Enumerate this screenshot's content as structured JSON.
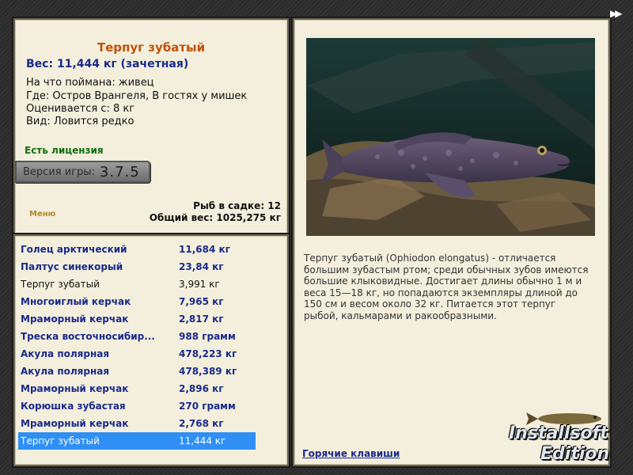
{
  "fish": {
    "title": "Терпуг зубатый",
    "weight": "Вес: 11,444 кг (зачетная)",
    "caught_on": "На что поймана: живец",
    "location": "Где: Остров Врангеля, В гостях у мишек",
    "valued_from": "Оценивается с: 8 кг",
    "species_note": "Вид: Ловится редко"
  },
  "license": "Есть лицензия",
  "version": {
    "label": "Версия игры:",
    "value": "3.7.5"
  },
  "menu_label": "Меню",
  "cage": {
    "count": "Рыб в садке: 12",
    "total": "Общий вес: 1025,275 кг"
  },
  "catch_list": [
    {
      "name": "Голец арктический",
      "weight": "11,684 кг",
      "style": "normal"
    },
    {
      "name": "Палтус синекорый",
      "weight": "23,84 кг",
      "style": "normal"
    },
    {
      "name": "Терпуг зубатый",
      "weight": "3,991 кг",
      "style": "plain"
    },
    {
      "name": "Многоиглый керчак",
      "weight": "7,965 кг",
      "style": "normal"
    },
    {
      "name": "Мраморный керчак",
      "weight": "2,817 кг",
      "style": "normal"
    },
    {
      "name": "Треска восточносибир...",
      "weight": "988 грамм",
      "style": "normal"
    },
    {
      "name": "Акула полярная",
      "weight": "478,223 кг",
      "style": "normal"
    },
    {
      "name": "Акула полярная",
      "weight": "478,389 кг",
      "style": "normal"
    },
    {
      "name": "Мраморный керчак",
      "weight": "2,896 кг",
      "style": "normal"
    },
    {
      "name": "Корюшка зубастая",
      "weight": "270 грамм",
      "style": "normal"
    },
    {
      "name": "Мраморный керчак",
      "weight": "2,768 кг",
      "style": "normal"
    },
    {
      "name": "Терпуг зубатый",
      "weight": "11,444 кг",
      "style": "selected"
    }
  ],
  "description": "Терпуг зубатый (Ophiodon elongatus) - отличается большим зубастым ртом; среди обычных зубов имеются большие клыковидные. Достигает длины обычно 1 м и веса 15—18 кг, но попадаются экземпляры длиной до 150 см и весом около 32 кг. Питается этот терпуг рыбой, кальмарами и ракообразными.",
  "hotkeys_link": "Горячие клавиши",
  "nav_arrows": "▶▶",
  "logo": {
    "line1": "Installsoft",
    "line2": "Edition"
  },
  "colors": {
    "accent_title": "#c0520c",
    "link_blue": "#1a2a8a",
    "license_green": "#0e6e0e",
    "selected_row": "#2f8ff5",
    "panel_bg": "#f3efdc"
  }
}
